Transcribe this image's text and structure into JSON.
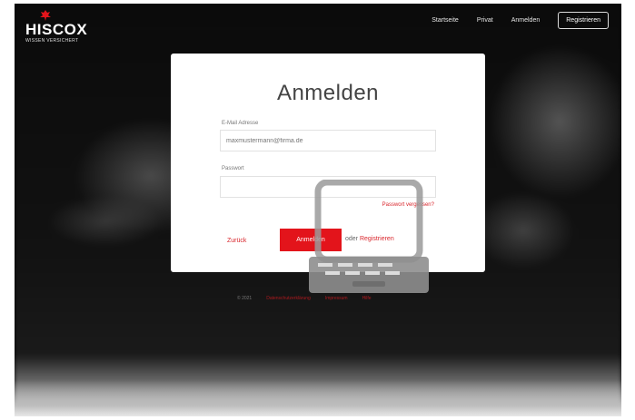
{
  "header": {
    "logo_text": "HISCOX",
    "logo_sub": "WISSEN VERSICHERT",
    "nav": {
      "startseite": "Startseite",
      "about": "Privat",
      "login": "Anmelden",
      "register": "Registrieren"
    }
  },
  "login": {
    "title": "Anmelden",
    "email_label": "E-Mail Adresse",
    "email_placeholder": "maxmustermann@firma.de",
    "password_label": "Passwort",
    "forgot_link": "Passwort vergessen?",
    "back_link": "Zurück",
    "submit_label": "Anmelden",
    "or_text": "oder",
    "register_link": "Registrieren"
  },
  "footer": {
    "copyright": "© 2021",
    "privacy": "Datenschutzerklärung",
    "imprint": "Impressum",
    "help": "Hilfe"
  },
  "colors": {
    "accent": "#e3141b",
    "card_bg": "#ffffff",
    "page_bg": "#050505"
  },
  "icons": {
    "logo": "hiscox-crest-icon",
    "overlay": "laptop-icon"
  }
}
